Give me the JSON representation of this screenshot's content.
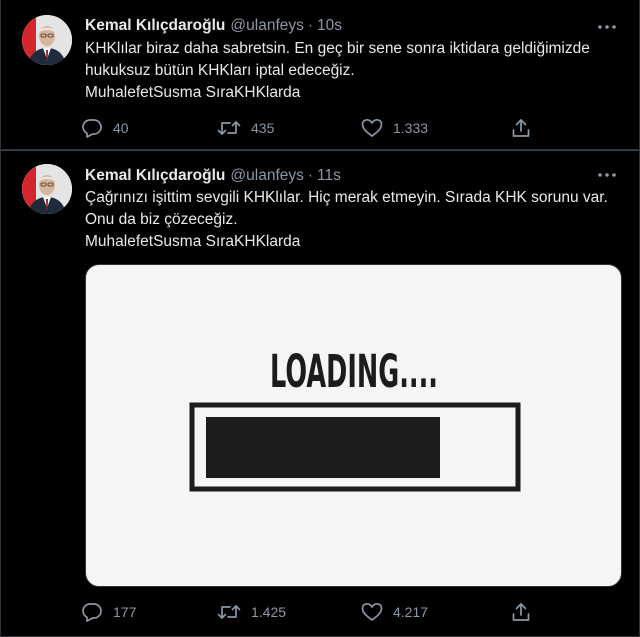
{
  "tweets": [
    {
      "author_name": "Kemal Kılıçdaroğlu",
      "handle": "@ulanfeys",
      "separator": "·",
      "time": "10s",
      "text_lines": [
        "KHKlılar biraz daha sabretsin. En geç bir sene sonra iktidara geldiğimizde",
        "hukuksuz bütün KHKları iptal edeceğiz.",
        "MuhalefetSusma SıraKHKlarda"
      ],
      "replies": "40",
      "retweets": "435",
      "likes": "1.333"
    },
    {
      "author_name": "Kemal Kılıçdaroğlu",
      "handle": "@ulanfeys",
      "separator": "·",
      "time": "11s",
      "text_lines": [
        "Çağrınızı işittim sevgili KHKlılar. Hiç merak etmeyin. Sırada KHK sorunu var.",
        "Onu da biz çözeceğiz.",
        "MuhalefetSusma SıraKHKlarda"
      ],
      "media": {
        "loading_text": "LOADING....",
        "progress_fraction": 0.74
      },
      "replies": "177",
      "retweets": "1.425",
      "likes": "4.217"
    }
  ],
  "icons": {
    "more": "more-horizontal-icon",
    "reply": "reply-icon",
    "retweet": "retweet-icon",
    "like": "heart-icon",
    "share": "share-icon"
  },
  "colors": {
    "background": "#000000",
    "text_primary": "#e7e9ea",
    "text_secondary": "#8b98a5",
    "divider": "#2f3336"
  }
}
